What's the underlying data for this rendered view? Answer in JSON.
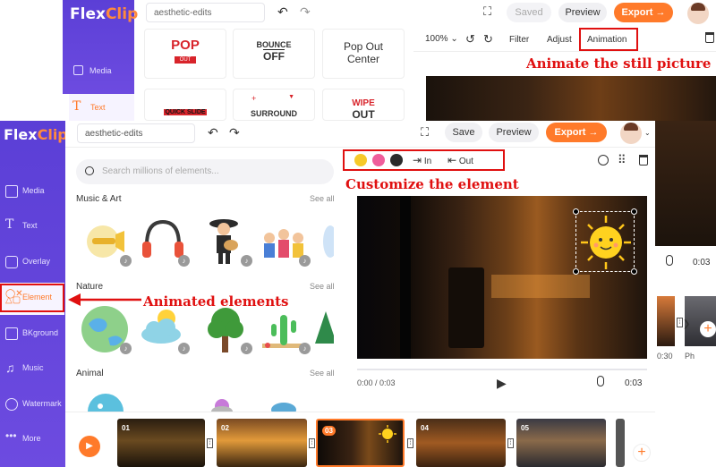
{
  "back": {
    "logo": {
      "flex": "Flex",
      "clip": "Clip"
    },
    "project_name": "aesthetic-edits",
    "saved_label": "Saved",
    "preview_label": "Preview",
    "export_label": "Export →",
    "sidebar": [
      {
        "label": "Media"
      },
      {
        "label": "Text"
      }
    ],
    "text_cards": [
      {
        "line1": "POP",
        "line2": "OUT"
      },
      {
        "line1": "BOUNCE",
        "line2": "OFF"
      },
      {
        "line1": "Pop Out",
        "line2": "Center"
      },
      {
        "line1": "QUICK SLIDE",
        "line2": ""
      },
      {
        "line1": "SURROUND",
        "line2": ""
      },
      {
        "line1": "WIPE",
        "line2": "OUT"
      }
    ],
    "zoom": "100%",
    "tabs": {
      "filter": "Filter",
      "adjust": "Adjust",
      "animation": "Animation"
    },
    "time_right": "0:03",
    "timeline_labels": [
      "0:30",
      "Ph"
    ]
  },
  "front": {
    "logo": {
      "flex": "Flex",
      "clip": "Clip"
    },
    "project_name": "aesthetic-edits",
    "save_label": "Save",
    "preview_label": "Preview",
    "export_label": "Export →",
    "search_placeholder": "Search millions of elements...",
    "sidebar": [
      {
        "label": "Media"
      },
      {
        "label": "Text"
      },
      {
        "label": "Overlay"
      },
      {
        "label": "Element"
      },
      {
        "label": "BKground"
      },
      {
        "label": "Music"
      },
      {
        "label": "Watermark"
      },
      {
        "label": "More"
      }
    ],
    "sections": [
      {
        "title": "Music & Art",
        "see_all": "See all"
      },
      {
        "title": "Nature",
        "see_all": "See all"
      },
      {
        "title": "Animal",
        "see_all": "See all"
      }
    ],
    "toolbar": {
      "in_label": "In",
      "out_label": "Out"
    },
    "toolbar_colors": [
      "#f6c92a",
      "#ef5e9b",
      "#2b2b2b"
    ],
    "time_current": "0:00 / 0:03",
    "time_end": "0:03",
    "clips": [
      {
        "num": "01"
      },
      {
        "num": "02"
      },
      {
        "num": "03"
      },
      {
        "num": "04"
      },
      {
        "num": "05"
      }
    ]
  },
  "annotations": {
    "animate": "Animate the still picture",
    "customize": "Customize the element",
    "animated": "Animated elements"
  },
  "colors": {
    "accent": "#ff7a2a",
    "sidebar": "#5b3fd6",
    "annotation": "#e01010"
  }
}
